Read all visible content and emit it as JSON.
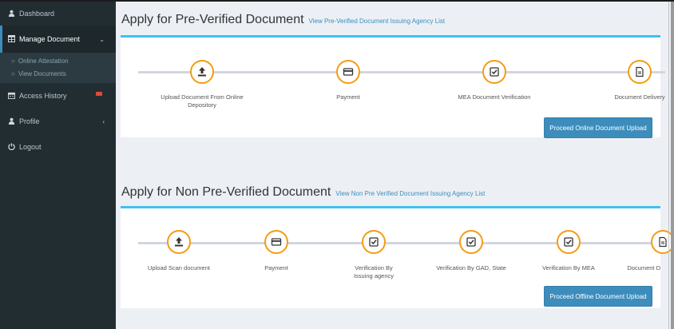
{
  "sidebar": {
    "items": [
      {
        "label": "Dashboard",
        "icon": "user-icon"
      },
      {
        "label": "Manage Document",
        "icon": "table-icon",
        "chevron": "⌄"
      },
      {
        "label": "Access History",
        "icon": "calendar-icon"
      },
      {
        "label": "Profile",
        "icon": "user-icon",
        "chevron": "‹"
      },
      {
        "label": "Logout",
        "icon": "logout-icon"
      }
    ],
    "submenu": [
      {
        "label": "Online Attestation",
        "icon": "circle-o-icon"
      },
      {
        "label": "View Documents",
        "icon": "circle-o-icon"
      }
    ]
  },
  "section1": {
    "title": "Apply for Pre-Verified Document",
    "link": "View Pre-Verified Document Issuing Agency List",
    "steps": [
      {
        "label": "Upload Document From Online Depository",
        "icon": "upload-icon"
      },
      {
        "label": "Payment",
        "icon": "credit-card-icon"
      },
      {
        "label": "MEA Document Verification",
        "icon": "check-square-icon"
      },
      {
        "label": "Document Delivery",
        "icon": "file-icon"
      }
    ],
    "button": "Proceed Online Document Upload"
  },
  "section2": {
    "title": "Apply for Non Pre-Verified Document",
    "link": "View Non Pre Verified Document Issuing Agency List",
    "steps": [
      {
        "label": "Upload Scan document",
        "icon": "upload-icon"
      },
      {
        "label": "Payment",
        "icon": "credit-card-icon"
      },
      {
        "label": "Verification By Issuing agency",
        "icon": "check-square-icon"
      },
      {
        "label": "Verification By GAD, State",
        "icon": "check-square-icon"
      },
      {
        "label": "Verification By MEA",
        "icon": "check-square-icon"
      },
      {
        "label": "Document D",
        "icon": "file-icon"
      }
    ],
    "button": "Proceed Offline Document Upload"
  },
  "colors": {
    "sidebar_bg": "#222d32",
    "accent": "#3c8dbc",
    "step_border": "#f39c12",
    "box_top": "#3fc1f0",
    "badge": "#dd4b39"
  }
}
